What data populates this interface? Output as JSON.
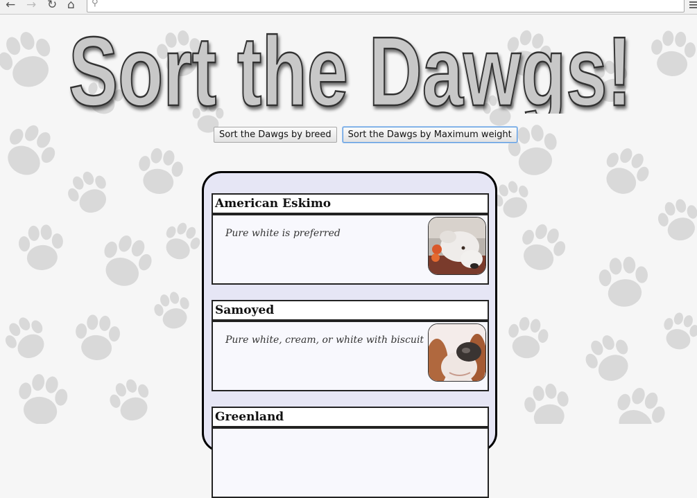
{
  "browser": {
    "icons": [
      "back-arrow-icon",
      "forward-arrow-icon",
      "reload-icon",
      "home-icon",
      "search-icon",
      "menu-icon"
    ],
    "address": {
      "value": "",
      "placeholder": ""
    }
  },
  "page": {
    "title": "Sort the Dawgs!",
    "buttons": {
      "sort_breed": "Sort the Dawgs by breed",
      "sort_weight": "Sort the Dawgs by Maximum weight"
    },
    "dogs": [
      {
        "breed": "American Eskimo",
        "description": "Pure white is preferred",
        "photo_icon": "white-dog-photo"
      },
      {
        "breed": "Samoyed",
        "description": "Pure white, cream, or white with biscuit",
        "photo_icon": "dog-nose-closeup-photo"
      },
      {
        "breed": "Greenland",
        "description": "",
        "photo_icon": ""
      }
    ]
  },
  "colors": {
    "background": "#f6f6f6",
    "paw": "#d9d9d9",
    "title_fill": "#c8c8c8",
    "list_bg": "#e6e6f5",
    "card_bg": "#f8f8fd",
    "button_focus": "#5b9be0"
  }
}
